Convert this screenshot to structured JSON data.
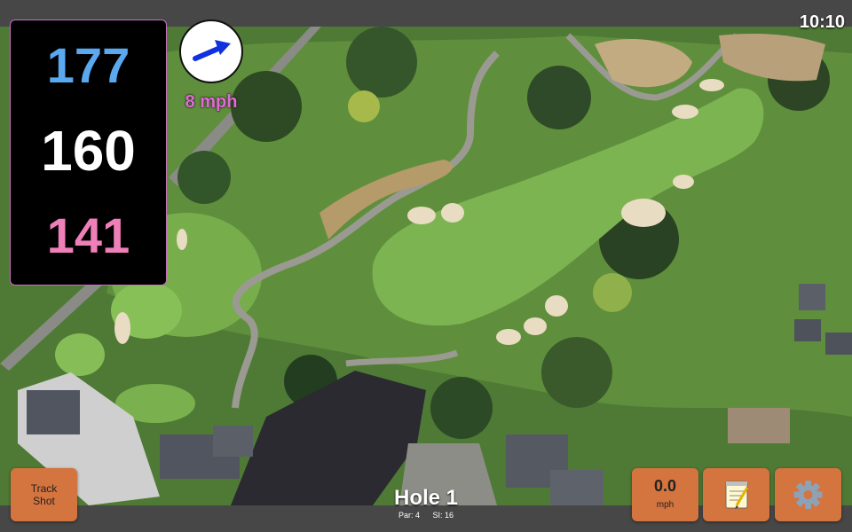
{
  "status": {
    "time": "10:10"
  },
  "yardage": {
    "back": "177",
    "middle": "160",
    "front": "141"
  },
  "wind": {
    "speed": "8 mph",
    "direction_icon": "arrow-northeast-icon"
  },
  "hole": {
    "title": "Hole 1",
    "par": "Par: 4",
    "stroke_index": "SI: 16"
  },
  "buttons": {
    "track_shot_line1": "Track",
    "track_shot_line2": "Shot",
    "speed_value": "0.0",
    "speed_unit": "mph",
    "notes_icon": "notepad-icon",
    "settings_icon": "gear-icon"
  },
  "colors": {
    "back_yardage": "#5aa8f0",
    "middle_yardage": "#ffffff",
    "front_yardage": "#ee7fb8",
    "wind_text": "#e06ad6",
    "button": "#d4743f"
  }
}
